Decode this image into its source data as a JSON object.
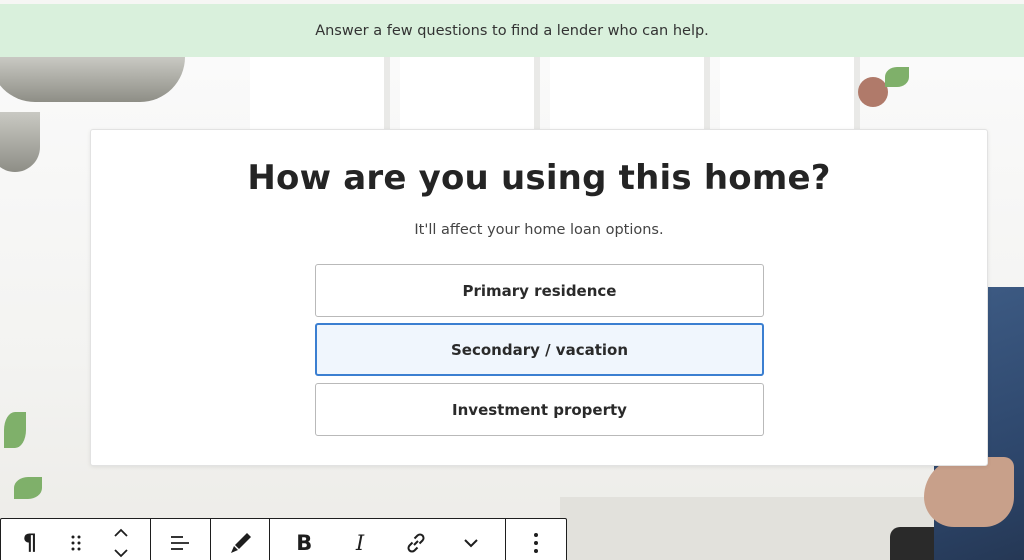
{
  "banner": {
    "text": "Answer a few questions to find a lender who can help."
  },
  "card": {
    "title": "How are you using this home?",
    "subtitle": "It'll affect your home loan options.",
    "options": [
      {
        "label": "Primary residence",
        "selected": false
      },
      {
        "label": "Secondary / vacation",
        "selected": true
      },
      {
        "label": "Investment property",
        "selected": false
      }
    ]
  },
  "colors": {
    "banner_bg": "#d9f0dc",
    "selected_border": "#3b7fd1",
    "selected_bg": "#f0f6fd"
  },
  "toolbar": {
    "buttons": [
      {
        "name": "paragraph-icon",
        "glyph": "¶"
      },
      {
        "name": "drag-handle-icon"
      },
      {
        "name": "move-up-down-icon"
      },
      {
        "name": "align-icon"
      },
      {
        "name": "highlight-brush-icon"
      },
      {
        "name": "bold-button",
        "glyph": "B"
      },
      {
        "name": "italic-button",
        "glyph": "I"
      },
      {
        "name": "link-icon"
      },
      {
        "name": "more-rich-text-chevron-icon"
      },
      {
        "name": "options-kebab-icon"
      }
    ]
  }
}
